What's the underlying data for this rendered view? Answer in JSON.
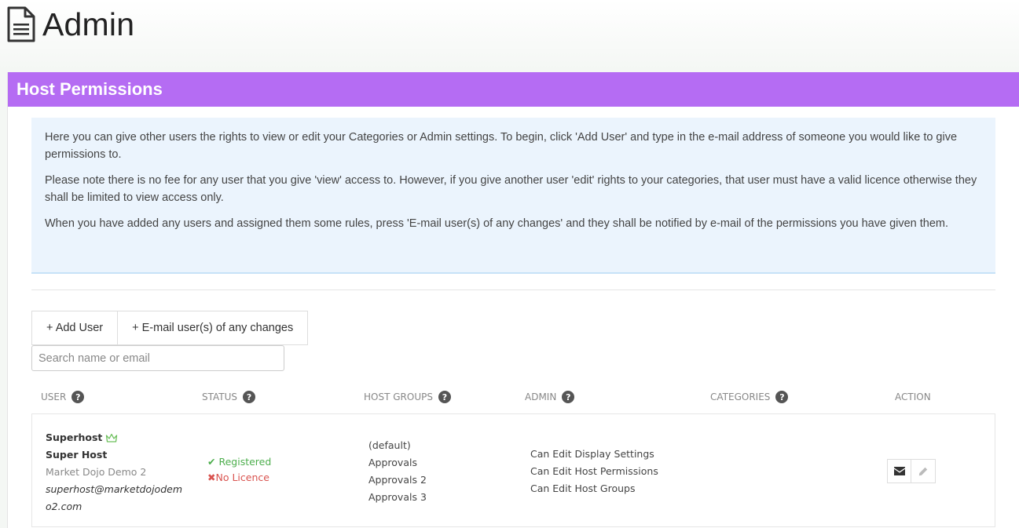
{
  "page": {
    "title": "Admin",
    "icon": "document-icon"
  },
  "panel": {
    "heading": "Host Permissions"
  },
  "info": {
    "paragraphs": [
      "Here you can give other users the rights to view or edit your Categories or Admin settings. To begin, click 'Add User' and type in the e-mail address of someone you would like to give permissions to.",
      "Please note there is no fee for any user that you give 'view' access to. However, if you give another user 'edit' rights to your categories, that user must have a valid licence otherwise they shall be limited to view access only.",
      "When you have added any users and assigned them some rules, press 'E-mail user(s) of any changes' and they shall be notified by e-mail of the permissions you have given them."
    ]
  },
  "toolbar": {
    "add_user": "+ Add User",
    "email_users": "+ E-mail user(s) of any changes"
  },
  "search": {
    "placeholder": "Search name or email",
    "value": ""
  },
  "table": {
    "headers": [
      "USER",
      "STATUS",
      "HOST GROUPS",
      "ADMIN",
      "CATEGORIES",
      "ACTION"
    ],
    "rows": [
      {
        "username": "Superhost",
        "full_name": "Super Host",
        "company": "Market Dojo Demo 2",
        "email": "superhost@marketdojodemo2.com",
        "status_registered": "Registered",
        "status_licence": "No Licence",
        "host_groups": [
          "(default)",
          "Approvals",
          "Approvals 2",
          "Approvals 3"
        ],
        "admin": [
          "Can Edit Display Settings",
          "Can Edit Host Permissions",
          "Can Edit Host Groups"
        ],
        "categories": []
      }
    ]
  },
  "colors": {
    "accent": "#b56cf3",
    "info_bg": "#ebf4fd",
    "success": "#4cae4c",
    "danger": "#d9534f",
    "crown": "#6cbf5b"
  }
}
